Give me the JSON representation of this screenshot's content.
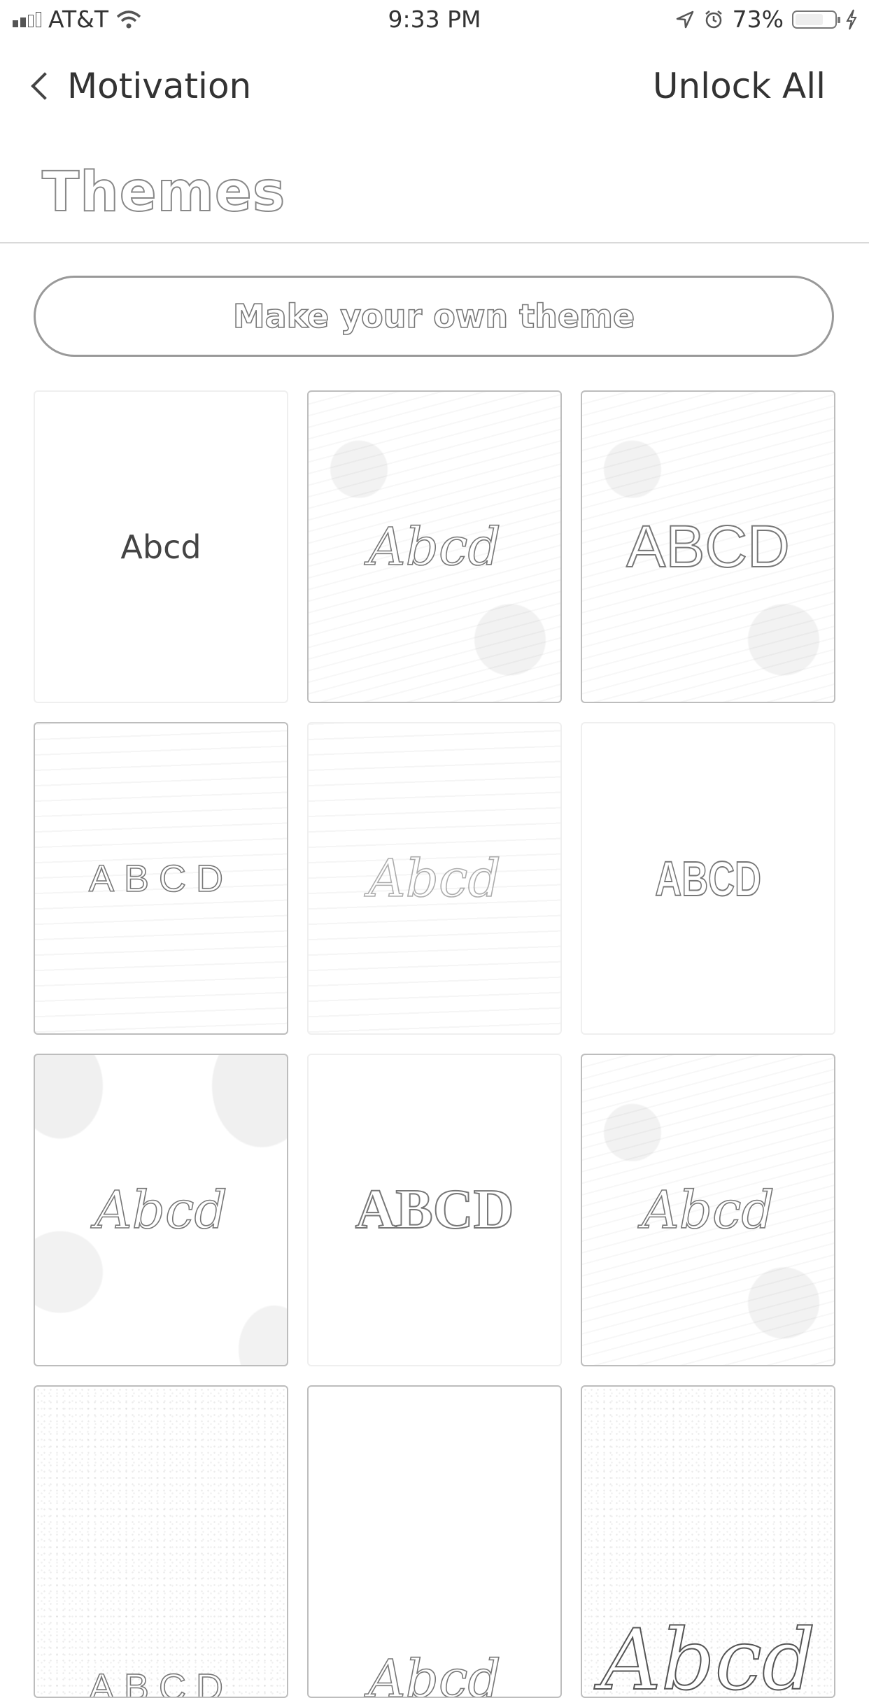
{
  "status_bar": {
    "carrier": "AT&T",
    "time": "9:33 PM",
    "battery_percent": "73%",
    "battery_level": 0.73,
    "icons": [
      "signal-icon",
      "wifi-icon",
      "location-arrow-icon",
      "alarm-clock-icon",
      "battery-icon",
      "charging-bolt-icon"
    ]
  },
  "nav": {
    "back_label": "Motivation",
    "action_label": "Unlock All"
  },
  "page": {
    "title": "Themes",
    "make_own_label": "Make your own theme"
  },
  "themes": [
    {
      "sample": "Abcd"
    },
    {
      "sample": "Abcd"
    },
    {
      "sample": "ABCD"
    },
    {
      "sample": "ABCD"
    },
    {
      "sample": "Abcd"
    },
    {
      "sample": "ABCD"
    },
    {
      "sample": "Abcd"
    },
    {
      "sample": "ABCD"
    },
    {
      "sample": "Abcd"
    },
    {
      "sample": "ABCD"
    },
    {
      "sample": "Abcd"
    },
    {
      "sample": "Abcd"
    }
  ]
}
